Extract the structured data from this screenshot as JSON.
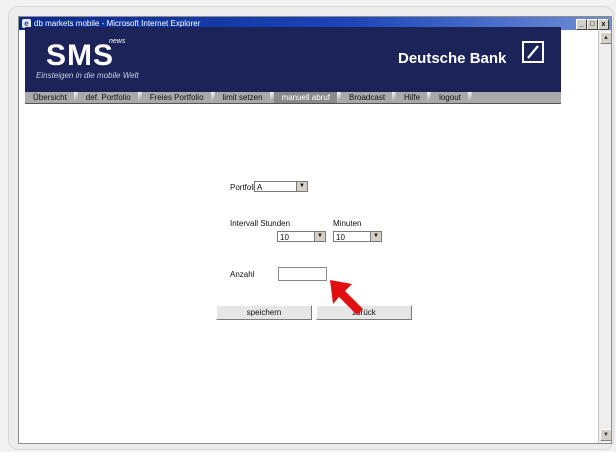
{
  "window": {
    "title": "db markets mobile - Microsoft Internet Explorer",
    "icon": "ie-icon",
    "controls": {
      "minimize": "_",
      "maximize": "□",
      "close": "x"
    }
  },
  "header": {
    "logo": "SMS",
    "logo_superscript": "news",
    "tagline": "Einsteigen in die mobile Welt",
    "brand": "Deutsche Bank"
  },
  "tabs": [
    {
      "label": "Übersicht",
      "active": false
    },
    {
      "label": "def. Portfolio",
      "active": false
    },
    {
      "label": "Freies Portfolio",
      "active": false
    },
    {
      "label": "limit setzen",
      "active": false
    },
    {
      "label": "manuell abruf",
      "active": true
    },
    {
      "label": "Broadcast",
      "active": false
    },
    {
      "label": "Hilfe",
      "active": false
    },
    {
      "label": "logout",
      "active": false
    }
  ],
  "form": {
    "portfolio_label": "Portfolio",
    "portfolio_value": "A",
    "interval_label": "Intervall Stunden",
    "minutes_label": "Minuten",
    "hours_value": "10",
    "minutes_value": "10",
    "anzahl_label": "Anzahl",
    "anzahl_value": "",
    "save_button": "speichern",
    "back_button": "zurück"
  },
  "colors": {
    "header_bg": "#1b2358",
    "titlebar": "#0b2a8c",
    "tab_bar": "#a9a9a9",
    "pointer_arrow": "#e01010"
  }
}
